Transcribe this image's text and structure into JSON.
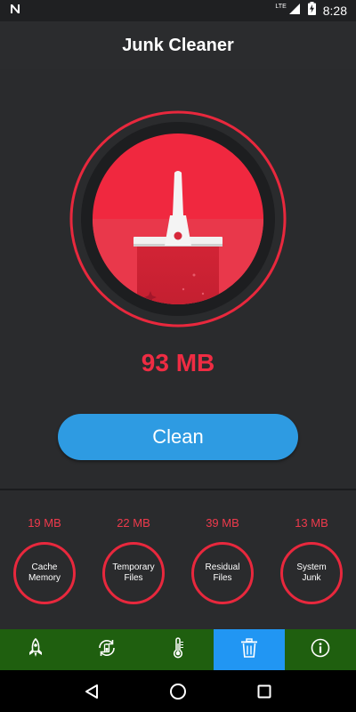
{
  "status_bar": {
    "time": "8:28",
    "network": "LTE",
    "icons": [
      "n-notification-icon",
      "lte-signal-icon",
      "battery-charging-icon"
    ]
  },
  "app_bar": {
    "title": "Junk Cleaner"
  },
  "main": {
    "junk_total": "93 MB",
    "clean_label": "Clean",
    "accent": "#ef2c43",
    "button_color": "#2e9be2"
  },
  "categories": [
    {
      "size": "19 MB",
      "label": "Cache\nMemory"
    },
    {
      "size": "22 MB",
      "label": "Temporary\nFiles"
    },
    {
      "size": "39 MB",
      "label": "Residual\nFiles"
    },
    {
      "size": "13 MB",
      "label": "System\nJunk"
    }
  ],
  "bottom_nav": {
    "items": [
      "rocket-icon",
      "battery-sync-icon",
      "thermometer-icon",
      "trash-icon",
      "info-icon"
    ],
    "active_index": 3,
    "bar_color": "#1f5f0f",
    "active_color": "#2196f3"
  },
  "system_nav": [
    "back-icon",
    "home-icon",
    "recents-icon"
  ]
}
